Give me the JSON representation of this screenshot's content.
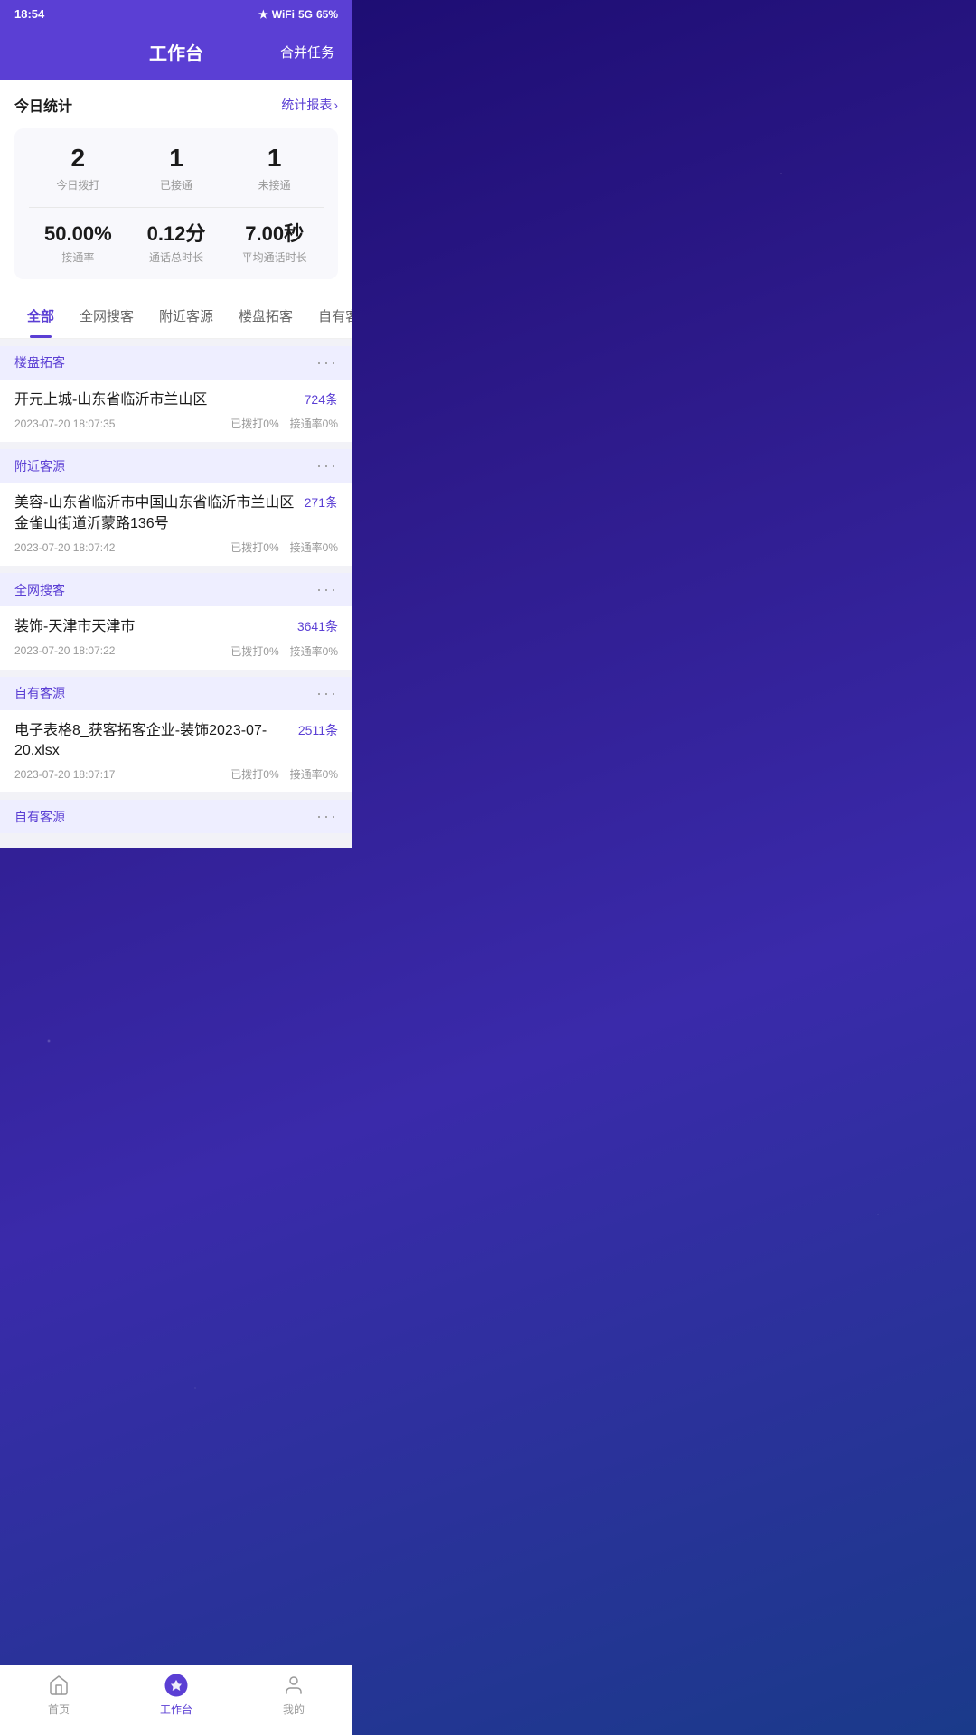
{
  "statusBar": {
    "time": "18:54",
    "batteryLevel": "65%"
  },
  "header": {
    "title": "工作台",
    "actionLabel": "合并任务"
  },
  "stats": {
    "sectionTitle": "今日统计",
    "linkLabel": "统计报表",
    "dialCount": "2",
    "dialLabel": "今日拨打",
    "connectedCount": "1",
    "connectedLabel": "已接通",
    "notConnectedCount": "1",
    "notConnectedLabel": "未接通",
    "connectRate": "50.00%",
    "connectRateLabel": "接通率",
    "totalDuration": "0.12分",
    "totalDurationLabel": "通话总时长",
    "avgDuration": "7.00秒",
    "avgDurationLabel": "平均通话时长"
  },
  "tabs": [
    {
      "label": "全部",
      "active": true
    },
    {
      "label": "全网搜客",
      "active": false
    },
    {
      "label": "附近客源",
      "active": false
    },
    {
      "label": "楼盘拓客",
      "active": false
    },
    {
      "label": "自有客源",
      "active": false
    }
  ],
  "tasks": [
    {
      "type": "楼盘拓客",
      "name": "开元上城-山东省临沂市兰山区",
      "count": "724条",
      "date": "2023-07-20 18:07:35",
      "dialStat": "已拨打0%",
      "connectStat": "接通率0%"
    },
    {
      "type": "附近客源",
      "name": "美容-山东省临沂市中国山东省临沂市兰山区金雀山街道沂蒙路136号",
      "count": "271条",
      "date": "2023-07-20 18:07:42",
      "dialStat": "已拨打0%",
      "connectStat": "接通率0%"
    },
    {
      "type": "全网搜客",
      "name": "装饰-天津市天津市",
      "count": "3641条",
      "date": "2023-07-20 18:07:22",
      "dialStat": "已拨打0%",
      "connectStat": "接通率0%"
    },
    {
      "type": "自有客源",
      "name": "电子表格8_获客拓客企业-装饰2023-07-20.xlsx",
      "count": "2511条",
      "date": "2023-07-20 18:07:17",
      "dialStat": "已拨打0%",
      "connectStat": "接通率0%"
    },
    {
      "type": "自有客源",
      "name": "",
      "count": "",
      "date": "",
      "dialStat": "",
      "connectStat": ""
    }
  ],
  "nav": [
    {
      "label": "首页",
      "active": false,
      "icon": "home"
    },
    {
      "label": "工作台",
      "active": true,
      "icon": "workbench"
    },
    {
      "label": "我的",
      "active": false,
      "icon": "profile"
    }
  ]
}
